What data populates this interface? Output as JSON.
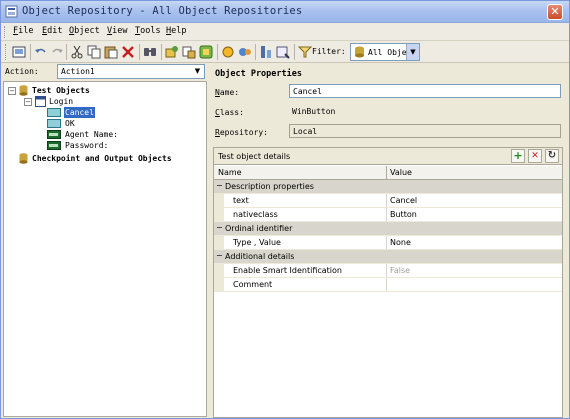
{
  "window": {
    "title": "Object Repository - All Object Repositories",
    "close_glyph": "✕"
  },
  "menu": [
    "File",
    "Edit",
    "Object",
    "View",
    "Tools",
    "Help"
  ],
  "toolbar": {
    "filter_label": "Filter:",
    "filter_value": "All Obje"
  },
  "action": {
    "label": "Action:",
    "value": "Action1"
  },
  "tree": {
    "root": "Test Objects",
    "window": "Login",
    "children": [
      "Cancel",
      "OK",
      "Agent Name:",
      "Password:"
    ],
    "checkpoint": "Checkpoint and Output Objects",
    "expander_glyph": "−"
  },
  "properties": {
    "title": "Object Properties",
    "name_label": "Name:",
    "name_value": "Cancel",
    "class_label": "Class:",
    "class_value": "WinButton",
    "repository_label": "Repository:",
    "repository_value": "Local"
  },
  "details": {
    "title": "Test object details",
    "add_glyph": "+",
    "remove_glyph": "✕",
    "refresh_glyph": "↻",
    "col_name": "Name",
    "col_value": "Value",
    "rows": [
      {
        "name": "Description properties",
        "value": "",
        "category": true
      },
      {
        "name": "text",
        "value": "Cancel",
        "category": false
      },
      {
        "name": "nativeclass",
        "value": "Button",
        "category": false
      },
      {
        "name": "Ordinal identifier",
        "value": "",
        "category": true
      },
      {
        "name": "Type , Value",
        "value": "None",
        "category": false
      },
      {
        "name": "Additional details",
        "value": "",
        "category": true
      },
      {
        "name": "Enable Smart Identification",
        "value": "False",
        "category": false
      },
      {
        "name": "Comment",
        "value": "",
        "category": false
      }
    ]
  },
  "colors": {
    "selection": "#316ac5",
    "panel": "#ece9d8",
    "category_row": "#d8d6cc",
    "add_green": "#1d8a1d",
    "remove_red": "#c41e1e"
  }
}
